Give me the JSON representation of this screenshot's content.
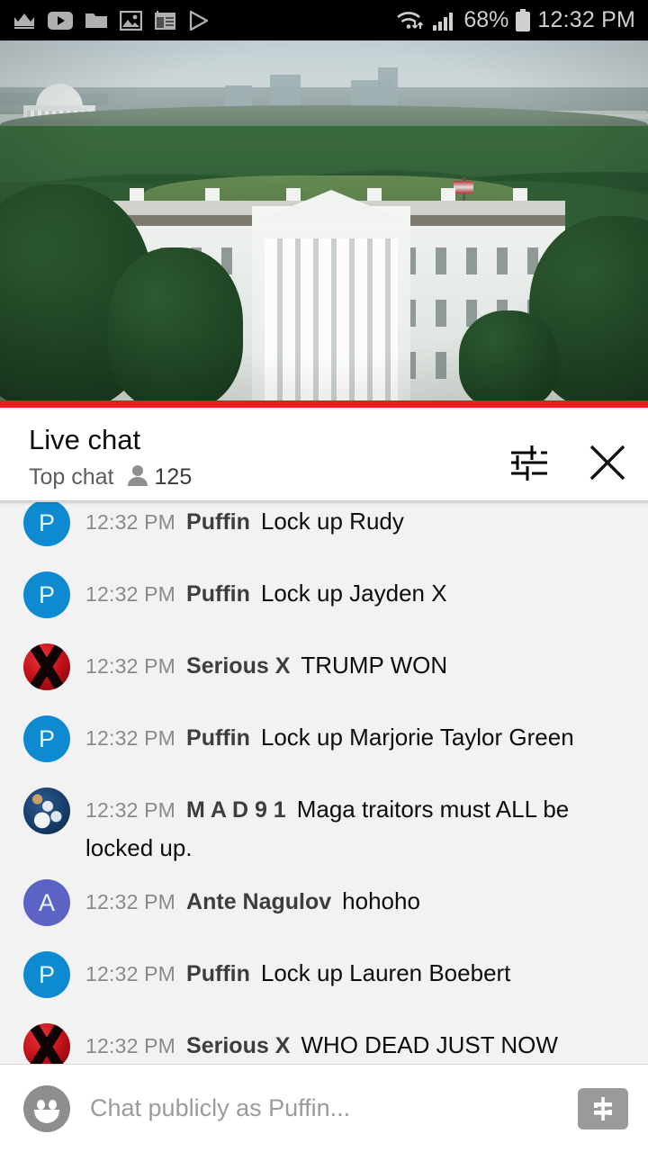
{
  "status_bar": {
    "time": "12:32 PM",
    "battery_percent": "68%",
    "left_icons": [
      "crown-icon",
      "youtube-icon",
      "folder-icon",
      "photos-icon",
      "notes-icon",
      "play-store-icon"
    ],
    "right_icons": [
      "wifi-icon",
      "signal-icon",
      "battery-icon"
    ]
  },
  "video": {
    "scene_description": "White House south lawn live stream",
    "progress_color": "#eb1c1c"
  },
  "chat_header": {
    "title": "Live chat",
    "mode": "Top chat",
    "viewer_count": "125",
    "settings_icon": "tune-icon",
    "close_icon": "close-icon"
  },
  "messages": [
    {
      "time": "12:32 PM",
      "author": "Puffin",
      "text": "Lock up Rudy",
      "avatar_type": "letter",
      "avatar_letter": "P",
      "avatar_color": "#0e8ad0"
    },
    {
      "time": "12:32 PM",
      "author": "Puffin",
      "text": "Lock up Jayden X",
      "avatar_type": "letter",
      "avatar_letter": "P",
      "avatar_color": "#0e8ad0"
    },
    {
      "time": "12:32 PM",
      "author": "Serious X",
      "text": "TRUMP WON",
      "avatar_type": "xbox",
      "avatar_letter": "",
      "avatar_color": "#c4121a"
    },
    {
      "time": "12:32 PM",
      "author": "Puffin",
      "text": "Lock up Marjorie Taylor Green",
      "avatar_type": "letter",
      "avatar_letter": "P",
      "avatar_color": "#0e8ad0"
    },
    {
      "time": "12:32 PM",
      "author": "M A D 9 1",
      "text": "Maga traitors must ALL be locked up.",
      "avatar_type": "earth",
      "avatar_letter": "",
      "avatar_color": "#2a5a92"
    },
    {
      "time": "12:32 PM",
      "author": "Ante Nagulov",
      "text": "hohoho",
      "avatar_type": "letter",
      "avatar_letter": "A",
      "avatar_color": "#5d63c4"
    },
    {
      "time": "12:32 PM",
      "author": "Puffin",
      "text": "Lock up Lauren Boebert",
      "avatar_type": "letter",
      "avatar_letter": "P",
      "avatar_color": "#0e8ad0"
    },
    {
      "time": "12:32 PM",
      "author": "Serious X",
      "text": "WHO DEAD JUST NOW",
      "avatar_type": "xbox",
      "avatar_letter": "",
      "avatar_color": "#c4121a"
    }
  ],
  "input_bar": {
    "placeholder": "Chat publicly as Puffin...",
    "value": "",
    "emoji_icon": "emoji-smiley-icon",
    "superchat_icon": "super-chat-dollar-icon"
  }
}
